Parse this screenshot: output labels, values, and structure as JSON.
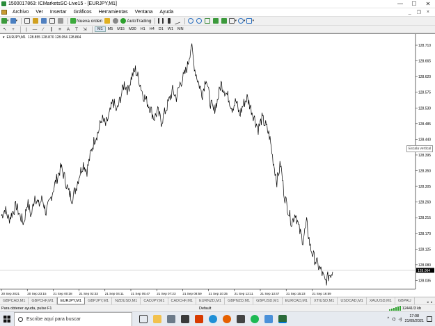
{
  "window": {
    "title": "1500017863: ICMarketsSC-Live15 - [EURJPY,M1]",
    "controls": [
      "—",
      "☐",
      "✕"
    ]
  },
  "menu": {
    "items": [
      "Archivo",
      "Ver",
      "Insertar",
      "Gráficos",
      "Herramientas",
      "Ventana",
      "Ayuda"
    ],
    "right_controls": [
      "_",
      "❐",
      "×"
    ]
  },
  "toolbar": {
    "new_order_label": "Nueva orden",
    "autotrading_label": "AutoTrading",
    "timeframes": [
      "M1",
      "M5",
      "M15",
      "M30",
      "H1",
      "H4",
      "D1",
      "W1",
      "MN"
    ],
    "active_timeframe": "M1"
  },
  "chart": {
    "symbol_label": "EURJPY,M1",
    "ohlc": "128.855 128.870 128.054 128.864",
    "tooltip": "Escala vertical",
    "current_price": "128.064"
  },
  "chart_data": {
    "type": "line",
    "title": "EURJPY,M1",
    "x_tick_labels": [
      "20 Sep 2021",
      "20 Sep 23:15",
      "21 Sep 00:38",
      "21 Sep 02:33",
      "21 Sep 04:11",
      "21 Sep 05:47",
      "21 Sep 07:23",
      "21 Sep 08:59",
      "21 Sep 10:35",
      "21 Sep 12:11",
      "21 Sep 13:47",
      "21 Sep 15:23",
      "21 Sep 16:59"
    ],
    "y_tick_labels": [
      "128.710",
      "128.665",
      "128.620",
      "128.575",
      "128.530",
      "128.485",
      "128.440",
      "128.395",
      "128.350",
      "128.305",
      "128.260",
      "128.215",
      "128.170",
      "128.125",
      "128.080",
      "128.035"
    ],
    "ylim": [
      128.01,
      128.73
    ],
    "series": [
      {
        "values": [
          128.22,
          128.24,
          128.21,
          128.23,
          128.25,
          128.22,
          128.2,
          128.26,
          128.22,
          128.28,
          128.25,
          128.27,
          128.23,
          128.26,
          128.3,
          128.33,
          128.36,
          128.33,
          128.29,
          128.27,
          128.3,
          128.34,
          128.37,
          128.35,
          128.4,
          128.44,
          128.46,
          128.5,
          128.48,
          128.51,
          128.55,
          128.52,
          128.56,
          128.6,
          128.58,
          128.62,
          128.64,
          128.61,
          128.57,
          128.55,
          128.53,
          128.5,
          128.52,
          128.49,
          128.52,
          128.55,
          128.58,
          128.56,
          128.6,
          128.62,
          128.65,
          128.71,
          128.64,
          128.6,
          128.57,
          128.62,
          128.55,
          128.52,
          128.55,
          128.6,
          128.58,
          128.56,
          128.53,
          128.55,
          128.51,
          128.54,
          128.56,
          128.53,
          128.5,
          128.47,
          128.5,
          128.48,
          128.45,
          128.38,
          128.32,
          128.37,
          128.28,
          128.24,
          128.2,
          128.23,
          128.18,
          128.15,
          128.2,
          128.13,
          128.1,
          128.08,
          128.06,
          128.03,
          128.05,
          128.06
        ]
      }
    ],
    "current_price_line": 128.064,
    "grid": false
  },
  "tabs": {
    "items": [
      "GBPCAD,M1",
      "GBPCHF,M1",
      "EURJPY,M1",
      "GBPJPY,M1",
      "NZDUSD,M1",
      "CADJPY,M1",
      "CADCHF,M1",
      "EURNZD,M1",
      "GBPNZD,M1",
      "GBPUSD,M1",
      "EURCAD,M1",
      "XTIUSD,M1",
      "USDCAD,M1",
      "XAUUSD,M1",
      "GBPAU"
    ],
    "active_index": 2
  },
  "status": {
    "help": "Para obtener ayuda, pulse F1",
    "profile": "Default",
    "connection": "12441/3 kb"
  },
  "taskbar": {
    "search_placeholder": "Escribe aquí para buscar",
    "time": "17:08",
    "date": "21/09/2021"
  }
}
